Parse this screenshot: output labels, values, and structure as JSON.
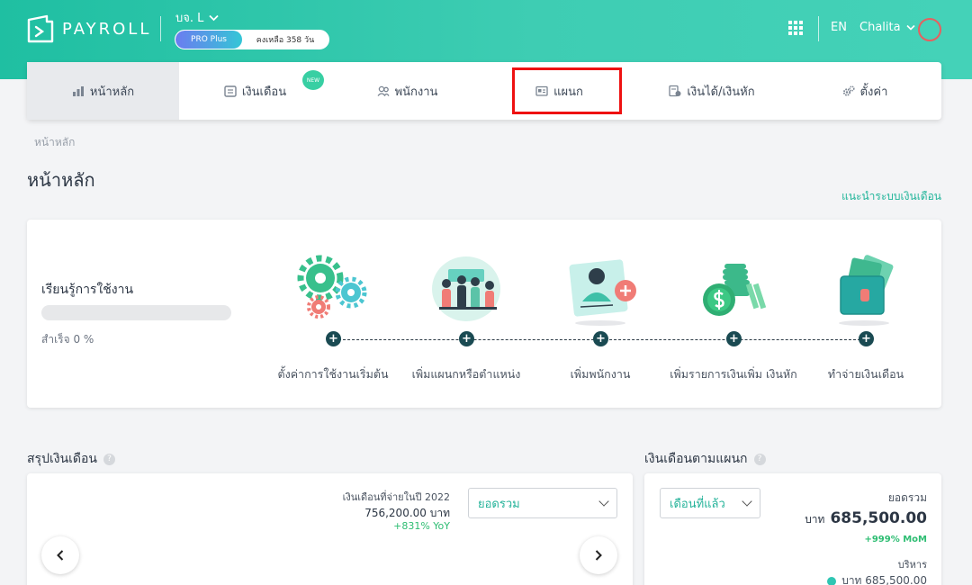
{
  "header": {
    "logo_text": "PAYROLL",
    "company_name": "บจ. L",
    "plan_name": "PRO Plus",
    "plan_remaining": "คงเหลือ 358 วัน",
    "language": "EN",
    "user_name": "Chalita"
  },
  "nav": {
    "items": [
      {
        "label": "หน้าหลัก",
        "icon": "chart-icon"
      },
      {
        "label": "เงินเดือน",
        "icon": "payroll-icon",
        "badge": "NEW"
      },
      {
        "label": "พนักงาน",
        "icon": "people-icon"
      },
      {
        "label": "แผนก",
        "icon": "department-icon"
      },
      {
        "label": "เงินได้/เงินหัก",
        "icon": "income-icon"
      },
      {
        "label": "ตั้งค่า",
        "icon": "gear-icon"
      }
    ]
  },
  "breadcrumb": "หน้าหลัก",
  "page_title": "หน้าหลัก",
  "guide_link": "แนะนำระบบเงินเดือน",
  "learn": {
    "title": "เรียนรู้การใช้งาน",
    "progress_text": "สำเร็จ 0 %",
    "progress_value": 0,
    "steps": [
      {
        "label": "ตั้งค่าการใช้งานเริ่มต้น"
      },
      {
        "label": "เพิ่มแผนกหรือตำแหน่ง"
      },
      {
        "label": "เพิ่มพนักงาน"
      },
      {
        "label": "เพิ่มรายการเงินเพิ่ม เงินหัก"
      },
      {
        "label": "ทำจ่ายเงินเดือน"
      }
    ]
  },
  "summary": {
    "title": "สรุปเงินเดือน",
    "paid_label": "เงินเดือนที่จ่ายในปี 2022",
    "paid_amount": "756,200.00 บาท",
    "yoy": "+831% YoY",
    "filter": "ยอดรวม",
    "prev": "‹",
    "next": "›"
  },
  "dept": {
    "title": "เงินเดือนตามแผนก",
    "filter": "เดือนที่แล้ว",
    "total_label": "ยอดรวม",
    "currency": "บาท",
    "total_amount": "685,500.00",
    "mom": "+999% MoM",
    "dept_name": "บริหาร",
    "dept_amount": "บาท 685,500.00"
  },
  "colors": {
    "brand": "#2fc6a8",
    "accent_text": "#22b59a",
    "highlight": "#ee1111",
    "positive": "#2dbd72"
  }
}
